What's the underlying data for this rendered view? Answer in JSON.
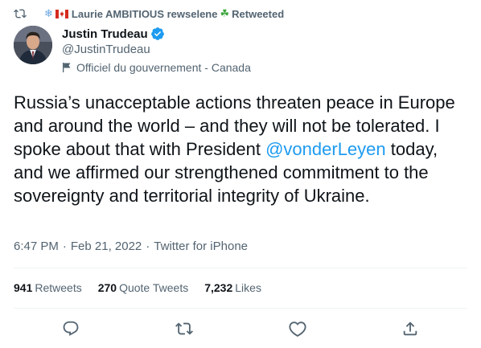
{
  "retweet_banner": {
    "user_name": "Laurie AMBITIOUS rewselene",
    "suffix": "Retweeted"
  },
  "author": {
    "display_name": "Justin Trudeau",
    "handle": "@JustinTrudeau",
    "label": "Officiel du gouvernement - Canada"
  },
  "tweet": {
    "text_before": "Russia’s unacceptable actions threaten peace in Europe and around the world – and they will not be tolerated. I spoke about that with President ",
    "mention": "@vonderLeyen",
    "text_after": " today, and we affirmed our strengthened commitment to the sovereignty and territorial integrity of Ukraine."
  },
  "meta": {
    "time": "6:47 PM",
    "date": "Feb 21, 2022",
    "source": "Twitter for iPhone",
    "separator": "·"
  },
  "stats": {
    "retweets_count": "941",
    "retweets_label": "Retweets",
    "quotes_count": "270",
    "quotes_label": "Quote Tweets",
    "likes_count": "7,232",
    "likes_label": "Likes"
  },
  "colors": {
    "accent": "#1d9bf0",
    "secondary_text": "#536471",
    "primary_text": "#0f1419"
  },
  "icons": {
    "banner": "retweet-icon",
    "verified": "verified-badge-icon",
    "government": "flag-icon",
    "actions": [
      "reply-icon",
      "retweet-icon",
      "like-icon",
      "share-icon"
    ]
  }
}
